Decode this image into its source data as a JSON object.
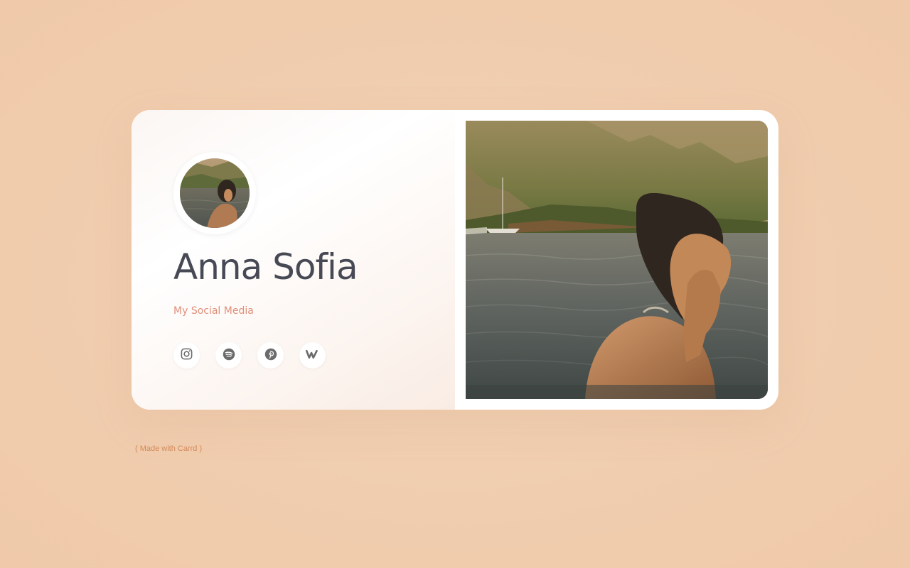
{
  "profile": {
    "name": "Anna Sofia",
    "tagline": "My Social Media"
  },
  "socials": [
    {
      "icon": "instagram-icon"
    },
    {
      "icon": "spotify-icon"
    },
    {
      "icon": "pinterest-icon"
    },
    {
      "icon": "wattpad-icon"
    }
  ],
  "footer": {
    "credit": "( Made with Carrd )"
  },
  "colors": {
    "background": "#f0cdb0",
    "name": "#474a55",
    "tagline": "#e0907a",
    "icon": "#6b6b6b",
    "credit": "#d38a5a"
  }
}
